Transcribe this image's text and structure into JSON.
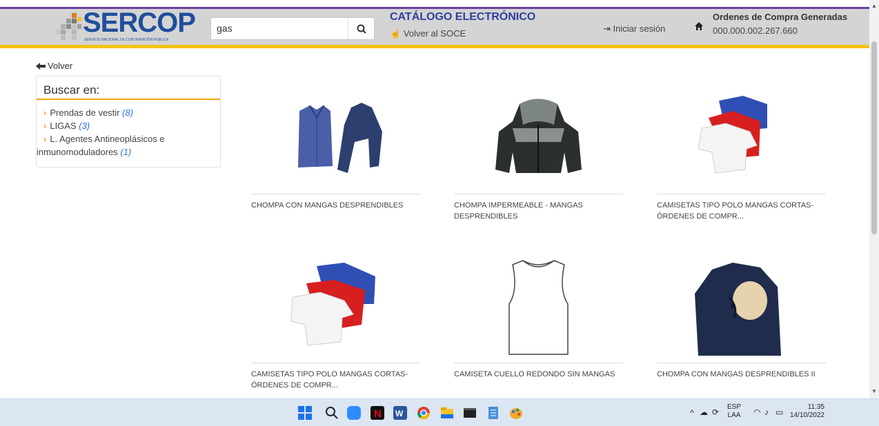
{
  "header": {
    "logo_text": "SERCOP",
    "logo_subtitle": "SERVICIO NACIONAL DE CONTRATACIÓN PÚBLICA",
    "search_value": "gas",
    "catalog_title": "CATÁLOGO ELECTRÓNICO",
    "back_to_soce": "Volver al SOCE",
    "login": "Iniciar sesión",
    "orders_title": "Ordenes de Compra Generadas",
    "orders_value": "000.000.002.267.660"
  },
  "back_link": "Volver",
  "search_panel": {
    "title": "Buscar en:",
    "items": [
      {
        "label": "Prendas de vestir",
        "count": "(8)"
      },
      {
        "label": "LIGAS",
        "count": "(3)"
      },
      {
        "label": "L. Agentes Antineoplásicos e inmunomoduladores",
        "count": "(1)"
      }
    ]
  },
  "products": [
    {
      "name": "CHOMPA CON MANGAS DESPRENDIBLES"
    },
    {
      "name": "CHOMPA IMPERMEABLE - MANGAS DESPRENDIBLES"
    },
    {
      "name": "CAMISETAS TIPO POLO MANGAS CORTAS-ÓRDENES DE COMPR..."
    },
    {
      "name": "CAMISETAS TIPO POLO MANGAS CORTAS-ÓRDENES DE COMPR..."
    },
    {
      "name": "CAMISETA CUELLO REDONDO SIN MANGAS"
    },
    {
      "name": "CHOMPA CON MANGAS DESPRENDIBLES II"
    }
  ],
  "taskbar": {
    "lang_line1": "ESP",
    "lang_line2": "LAA",
    "time": "11:35",
    "date": "14/10/2022"
  },
  "colors": {
    "accent_purple": "#6b3fa0",
    "accent_yellow": "#f2c316",
    "facet_orange": "#f2a516",
    "logo_blue": "#1f4e9c",
    "title_blue": "#2e3f9e"
  },
  "icons": [
    "search-icon",
    "hand-pointer-icon",
    "login-icon",
    "home-icon",
    "arrow-left-icon",
    "chevron-right-icon"
  ]
}
